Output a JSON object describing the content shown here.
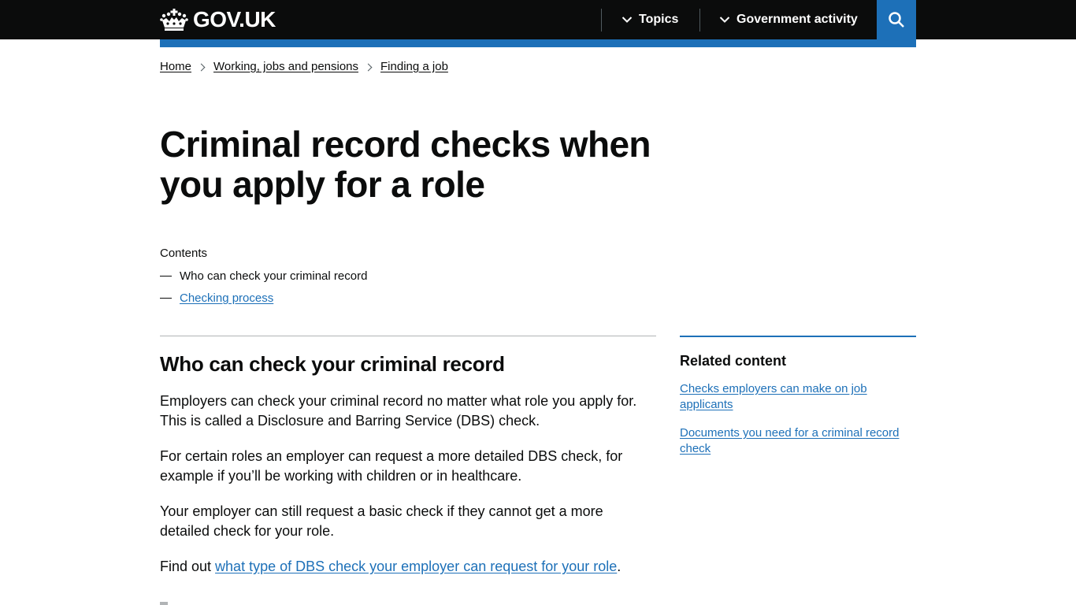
{
  "header": {
    "logo_text": "GOV.UK",
    "nav": [
      {
        "label": "Topics",
        "icon": "chevron-down-icon"
      },
      {
        "label": "Government activity",
        "icon": "chevron-down-icon"
      }
    ],
    "search_icon": "search-icon",
    "colors": {
      "background": "#0b0c0c",
      "accent": "#1d70b8"
    }
  },
  "breadcrumb": [
    {
      "label": "Home"
    },
    {
      "label": "Working, jobs and pensions"
    },
    {
      "label": "Finding a job"
    }
  ],
  "page_title": "Criminal record checks when you apply for a role",
  "contents": {
    "label": "Contents",
    "items": [
      {
        "label": "Who can check your criminal record",
        "current": true
      },
      {
        "label": "Checking process",
        "current": false
      }
    ]
  },
  "section": {
    "heading": "Who can check your criminal record",
    "paragraphs": [
      "Employers can check your criminal record no matter what role you apply for. This is called a Disclosure and Barring Service (DBS) check.",
      "For certain roles an employer can request a more detailed DBS check, for example if you’ll be working with children or in healthcare.",
      "Your employer can still request a basic check if they cannot get a more detailed check for your role."
    ],
    "find_out": {
      "prefix": "Find out ",
      "link": "what type of DBS check your employer can request for your role",
      "suffix": "."
    }
  },
  "related": {
    "title": "Related content",
    "links": [
      {
        "label": "Checks employers can make on job applicants"
      },
      {
        "label": "Documents you need for a criminal record check"
      }
    ]
  }
}
